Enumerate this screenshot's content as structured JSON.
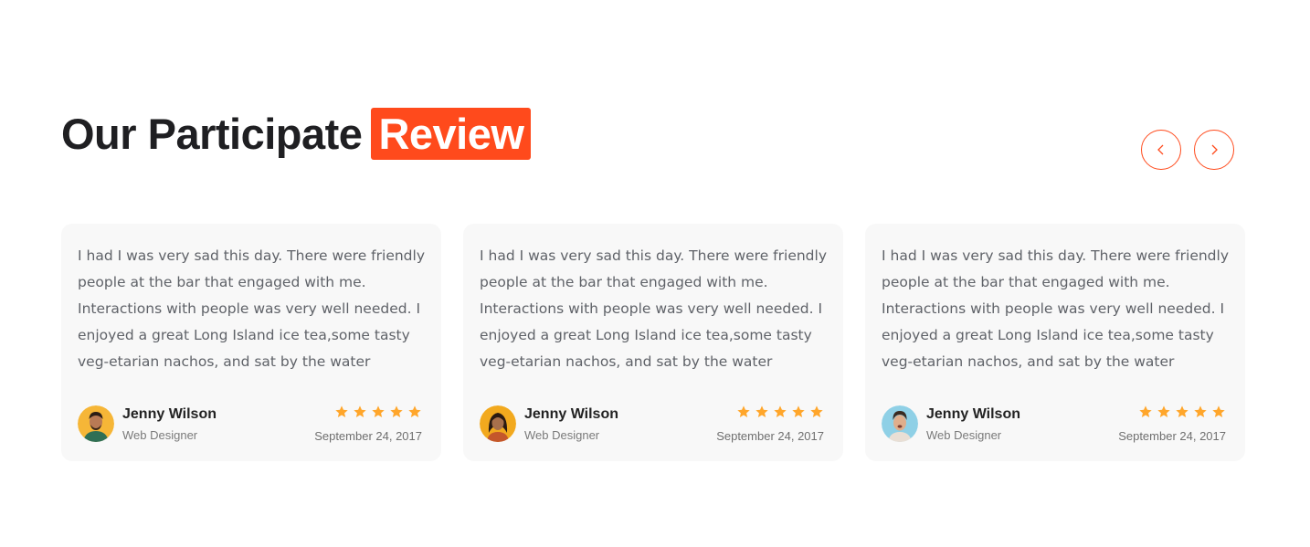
{
  "heading": {
    "text": "Our Participate",
    "highlight": "Review"
  },
  "navigation": {
    "prev_icon": "chevron-left-icon",
    "next_icon": "chevron-right-icon"
  },
  "colors": {
    "accent": "#ff4a1c",
    "star": "#ffa62b",
    "card_bg": "#f8f8f8"
  },
  "reviews": [
    {
      "text": "I had I was very sad this day. There were friendly people at the bar that engaged with me. Interactions with people was very well needed. I enjoyed a great Long Island ice tea,some tasty veg-etarian nachos, and sat by the water",
      "name": "Jenny Wilson",
      "role": "Web Designer",
      "rating": 5,
      "date": "September 24, 2017"
    },
    {
      "text": "I had I was very sad this day. There were friendly people at the bar that engaged with me. Interactions with people was very well needed. I enjoyed a great Long Island ice tea,some tasty veg-etarian nachos, and sat by the water",
      "name": "Jenny Wilson",
      "role": "Web Designer",
      "rating": 5,
      "date": "September 24, 2017"
    },
    {
      "text": "I had I was very sad this day. There were friendly people at the bar that engaged with me. Interactions with people was very well needed. I enjoyed a great Long Island ice tea,some tasty veg-etarian nachos, and sat by the water",
      "name": "Jenny Wilson",
      "role": "Web Designer",
      "rating": 5,
      "date": "September 24, 2017"
    }
  ]
}
